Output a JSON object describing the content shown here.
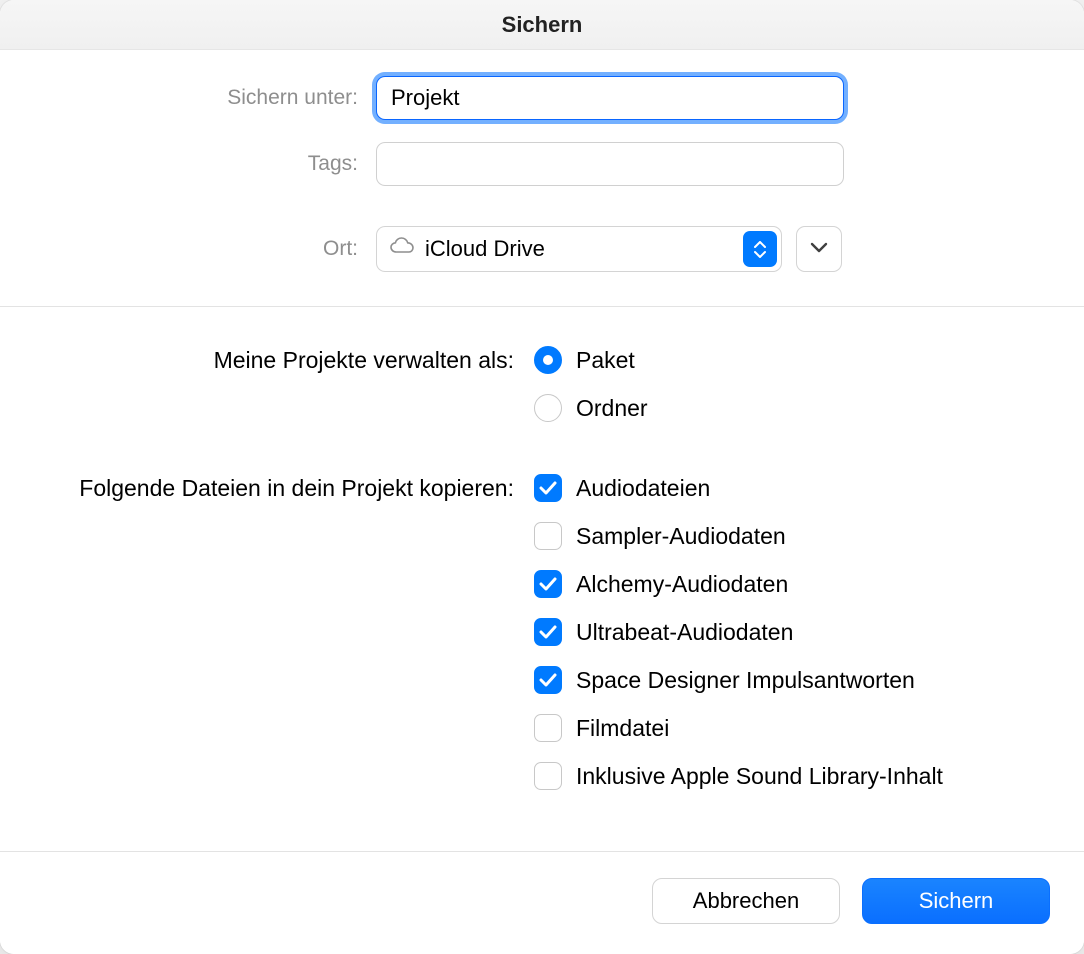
{
  "title": "Sichern",
  "labels": {
    "save_as": "Sichern unter:",
    "tags": "Tags:",
    "location": "Ort:"
  },
  "fields": {
    "filename": "Projekt",
    "tags": "",
    "location": "iCloud Drive"
  },
  "manage": {
    "label": "Meine Projekte verwalten als:",
    "options": [
      {
        "label": "Paket",
        "checked": true
      },
      {
        "label": "Ordner",
        "checked": false
      }
    ]
  },
  "copy": {
    "label": "Folgende Dateien in dein Projekt kopieren:",
    "items": [
      {
        "label": "Audiodateien",
        "checked": true
      },
      {
        "label": "Sampler-Audiodaten",
        "checked": false
      },
      {
        "label": "Alchemy-Audiodaten",
        "checked": true
      },
      {
        "label": "Ultrabeat-Audiodaten",
        "checked": true
      },
      {
        "label": "Space Designer Impulsantworten",
        "checked": true
      },
      {
        "label": "Filmdatei",
        "checked": false
      },
      {
        "label": "Inklusive Apple Sound Library-Inhalt",
        "checked": false
      }
    ]
  },
  "buttons": {
    "cancel": "Abbrechen",
    "save": "Sichern"
  }
}
